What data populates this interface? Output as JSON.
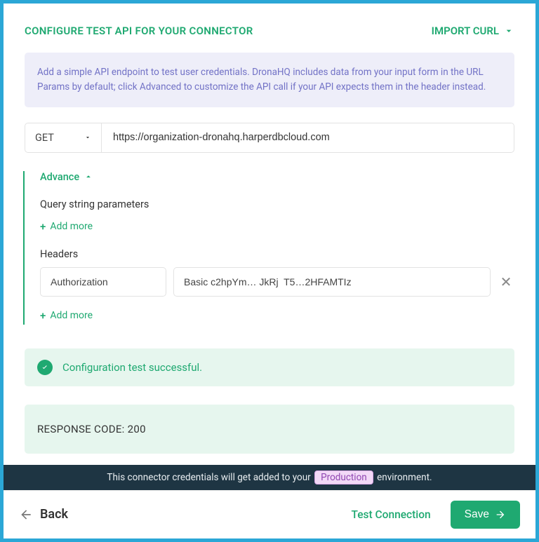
{
  "header": {
    "title": "CONFIGURE TEST API FOR YOUR CONNECTOR",
    "import_curl": "IMPORT CURL"
  },
  "info_text": "Add a simple API endpoint to test user credentials. DronaHQ includes data from your input form in the URL Params by default; click Advanced to customize the API call if your API expects them in the header instead.",
  "endpoint": {
    "method": "GET",
    "url": "https://organization-dronahq.harperdbcloud.com"
  },
  "advance": {
    "toggle_label": "Advance",
    "query_label": "Query string parameters",
    "headers_label": "Headers",
    "add_more_label": "Add more",
    "headers": [
      {
        "key": "Authorization",
        "value": "Basic c2hpYm… JkRj  T5…2HFAMTIz"
      }
    ]
  },
  "result": {
    "success_text": "Configuration test successful.",
    "response_code_label": "RESPONSE CODE: 200"
  },
  "env_bar": {
    "prefix": "This connector credentials will get added to your",
    "tag": "Production",
    "suffix": "environment."
  },
  "footer": {
    "back": "Back",
    "test_connection": "Test Connection",
    "save": "Save"
  }
}
